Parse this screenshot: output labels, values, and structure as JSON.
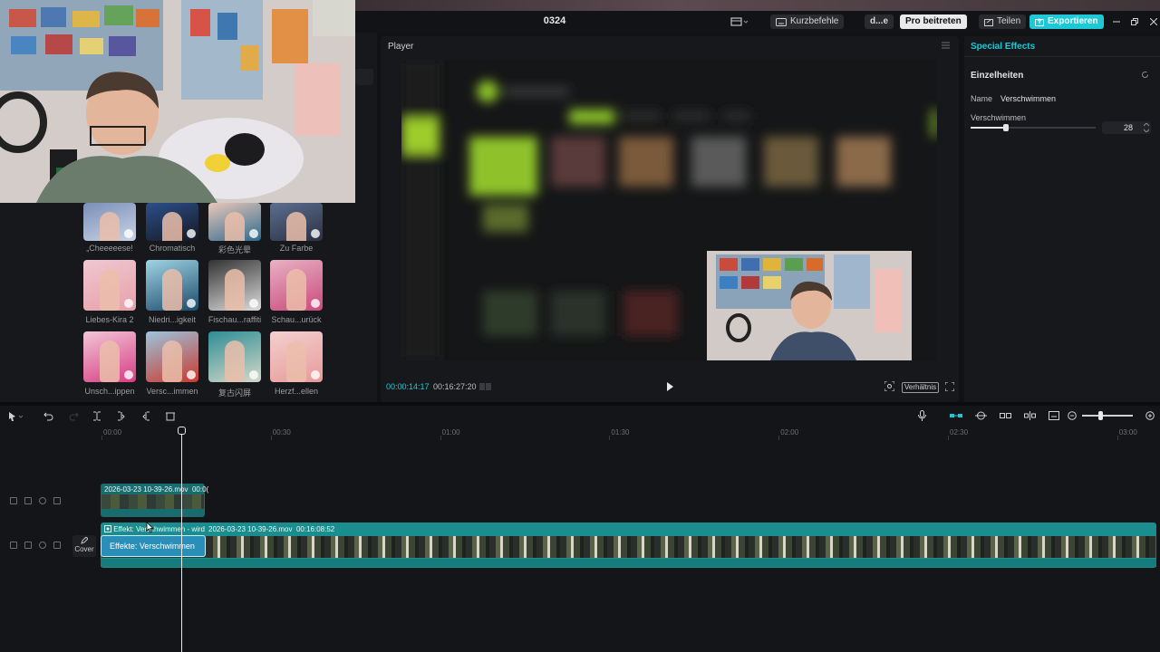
{
  "header": {
    "project_title": "0324",
    "shortcuts_label": "Kurzbefehle",
    "user_label": "d...e",
    "pro_label": "Pro beitreten",
    "share_label": "Teilen",
    "export_label": "Exportieren"
  },
  "effects_panel": {
    "items": [
      {
        "label": "„Cheeeeese! "
      },
      {
        "label": "Chromatisch"
      },
      {
        "label": "彩色光晕"
      },
      {
        "label": "Zu Farbe"
      },
      {
        "label": "Liebes-Kira 2"
      },
      {
        "label": "Niedri...igkeit"
      },
      {
        "label": "Fischau...raffiti"
      },
      {
        "label": "Schau...urück"
      },
      {
        "label": "Unsch...ippen"
      },
      {
        "label": "Versc...immen"
      },
      {
        "label": "复古闪屏"
      },
      {
        "label": "Herzf...ellen"
      }
    ]
  },
  "player": {
    "title": "Player",
    "current_time": "00:00:14:17",
    "total_time": "00:16:27:20",
    "ratio_label": "Verhältnis"
  },
  "special_effects": {
    "title": "Special Effects",
    "section": "Einzelheiten",
    "name_label": "Name",
    "name_value": "Verschwimmen",
    "param_label": "Verschwimmen",
    "param_value": "28",
    "param_fraction": 0.28
  },
  "timeline": {
    "ruler": [
      "00:00",
      "00:30",
      "01:00",
      "01:30",
      "02:00",
      "02:30",
      "03:00"
    ],
    "clip1_label": "2026-03-23 10-39-26.mov",
    "clip1_time": "00:0(",
    "main_effect_label": "Effekt: Verschwimmen - wird",
    "main_clip_label": "2026-03-23 10-39-26.mov",
    "main_clip_duration": "00:16:08:52",
    "effect_box_label": "Effekte: Verschwimmen",
    "cover_label": "Cover"
  },
  "colors": {
    "accent": "#1ec8d6",
    "clip": "#1a8e8f",
    "effect": "#2a8fb8"
  }
}
